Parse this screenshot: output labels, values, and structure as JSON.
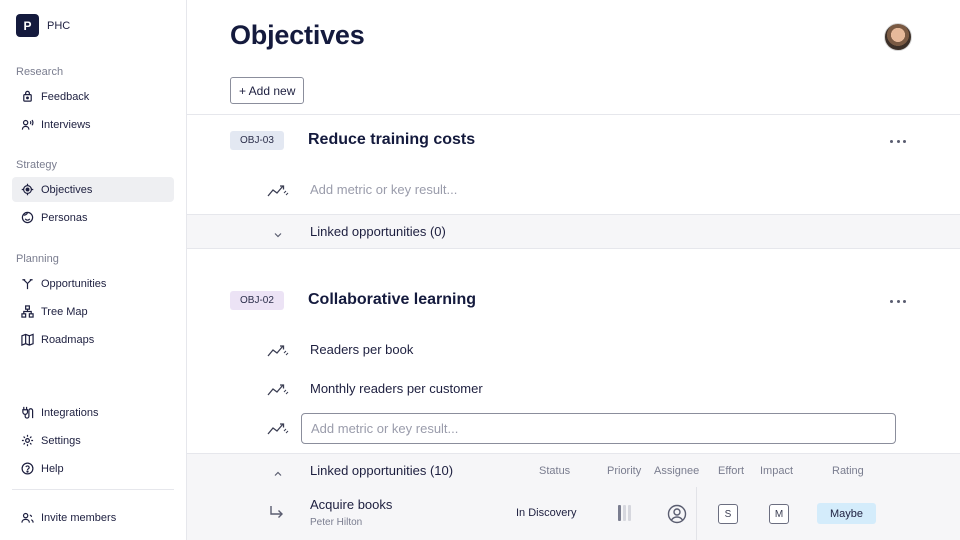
{
  "brand": {
    "logo_letter": "P",
    "name": "PHC"
  },
  "sidebar": {
    "sections": [
      {
        "title": "Research",
        "items": [
          {
            "label": "Feedback",
            "icon": "lock-box-icon"
          },
          {
            "label": "Interviews",
            "icon": "person-voice-icon"
          }
        ]
      },
      {
        "title": "Strategy",
        "items": [
          {
            "label": "Objectives",
            "icon": "target-icon",
            "active": true
          },
          {
            "label": "Personas",
            "icon": "face-icon"
          }
        ]
      },
      {
        "title": "Planning",
        "items": [
          {
            "label": "Opportunities",
            "icon": "fork-icon"
          },
          {
            "label": "Tree Map",
            "icon": "tree-icon"
          },
          {
            "label": "Roadmaps",
            "icon": "map-icon"
          }
        ]
      }
    ],
    "bottom_items": [
      {
        "label": "Integrations",
        "icon": "plug-icon"
      },
      {
        "label": "Settings",
        "icon": "gear-icon"
      },
      {
        "label": "Help",
        "icon": "help-icon"
      }
    ],
    "invite": {
      "label": "Invite members",
      "icon": "invite-icon"
    }
  },
  "header": {
    "title": "Objectives",
    "add_label": "+ Add new"
  },
  "objectives": [
    {
      "code": "OBJ-03",
      "code_color": "#e3e8f2",
      "title": "Reduce training costs",
      "metric_placeholder": "Add metric or key result...",
      "linked_label": "Linked opportunities (0)"
    },
    {
      "code": "OBJ-02",
      "code_color": "#ece3f5",
      "title": "Collaborative learning",
      "metrics": [
        "Readers per book",
        "Monthly readers per customer"
      ],
      "metric_placeholder": "Add metric or key result...",
      "linked_label": "Linked opportunities (10)",
      "columns": [
        "Status",
        "Priority",
        "Assignee",
        "Effort",
        "Impact",
        "Rating"
      ],
      "opportunities": [
        {
          "title": "Acquire books",
          "owner": "Peter Hilton",
          "status": "In Discovery",
          "priority_level": 1,
          "priority_max": 3,
          "effort": "S",
          "impact": "M",
          "rating": "Maybe",
          "rating_color": "#d4ecfb"
        }
      ]
    }
  ]
}
